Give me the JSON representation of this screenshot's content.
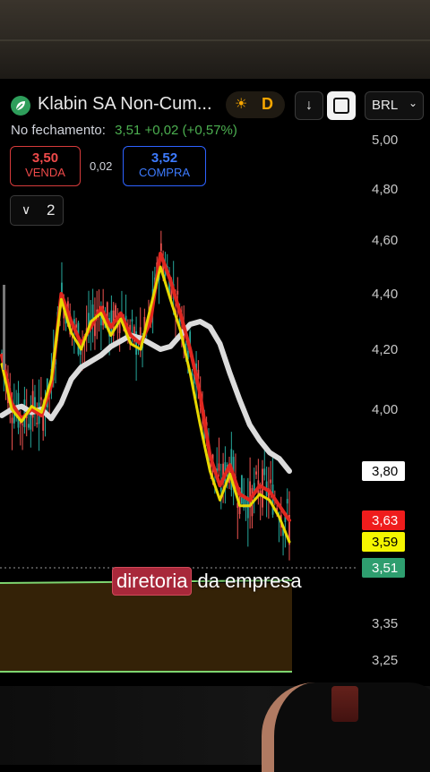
{
  "app": {
    "symbol_title": "Klabin SA Non-Cum...",
    "session_icon": "sun-icon",
    "session_letter": "D",
    "currency": "BRL",
    "close_label": "No fechamento:",
    "close_values": "3,51  +0,02 (+0,57%)",
    "sell": {
      "price": "3,50",
      "label": "VENDA"
    },
    "spread": "0,02",
    "buy": {
      "price": "3,52",
      "label": "COMPRA"
    },
    "indicators_count": "2",
    "caption_highlight": "diretoria",
    "caption_rest": "da empresa"
  },
  "colors": {
    "up": "#26a69a",
    "down": "#ef5350",
    "accent_sell": "#ef4a4a",
    "accent_buy": "#3d7bff"
  },
  "chart_data": {
    "type": "line",
    "y_ticks": [
      "5,00",
      "4,80",
      "4,60",
      "4,40",
      "4,20",
      "4,00",
      "3,35",
      "3,25"
    ],
    "ylim": [
      3.2,
      5.03
    ],
    "price_tags": [
      {
        "label": "3,80",
        "bg": "#ffffff",
        "fg": "#000000"
      },
      {
        "label": "3,63",
        "bg": "#ef1c1c",
        "fg": "#ffffff"
      },
      {
        "label": "3,59",
        "bg": "#f5f500",
        "fg": "#000000"
      },
      {
        "label": "3,51",
        "bg": "#2e9e6f",
        "fg": "#ffffff"
      }
    ],
    "series": [
      {
        "name": "",
        "color": "#dcdcdc",
        "values": [
          3.98,
          4.0,
          4.01,
          3.99,
          4.0,
          3.97,
          4.02,
          4.1,
          4.14,
          4.16,
          4.18,
          4.21,
          4.23,
          4.25,
          4.24,
          4.22,
          4.2,
          4.21,
          4.25,
          4.29,
          4.3,
          4.28,
          4.22,
          4.12,
          4.03,
          3.95,
          3.9,
          3.86,
          3.84,
          3.8
        ]
      },
      {
        "name": "",
        "color": "#e0271f",
        "values": [
          4.18,
          4.02,
          3.97,
          4.0,
          3.98,
          4.08,
          4.4,
          4.3,
          4.22,
          4.28,
          4.35,
          4.28,
          4.33,
          4.25,
          4.22,
          4.3,
          4.55,
          4.45,
          4.33,
          4.2,
          4.05,
          3.85,
          3.75,
          3.82,
          3.72,
          3.7,
          3.75,
          3.73,
          3.68,
          3.63
        ]
      },
      {
        "name": "",
        "color": "#e8d800",
        "values": [
          4.15,
          4.0,
          3.96,
          4.01,
          3.99,
          4.1,
          4.38,
          4.26,
          4.2,
          4.3,
          4.33,
          4.25,
          4.31,
          4.22,
          4.2,
          4.35,
          4.5,
          4.38,
          4.27,
          4.12,
          3.95,
          3.8,
          3.7,
          3.79,
          3.68,
          3.68,
          3.72,
          3.7,
          3.64,
          3.59
        ]
      }
    ]
  }
}
